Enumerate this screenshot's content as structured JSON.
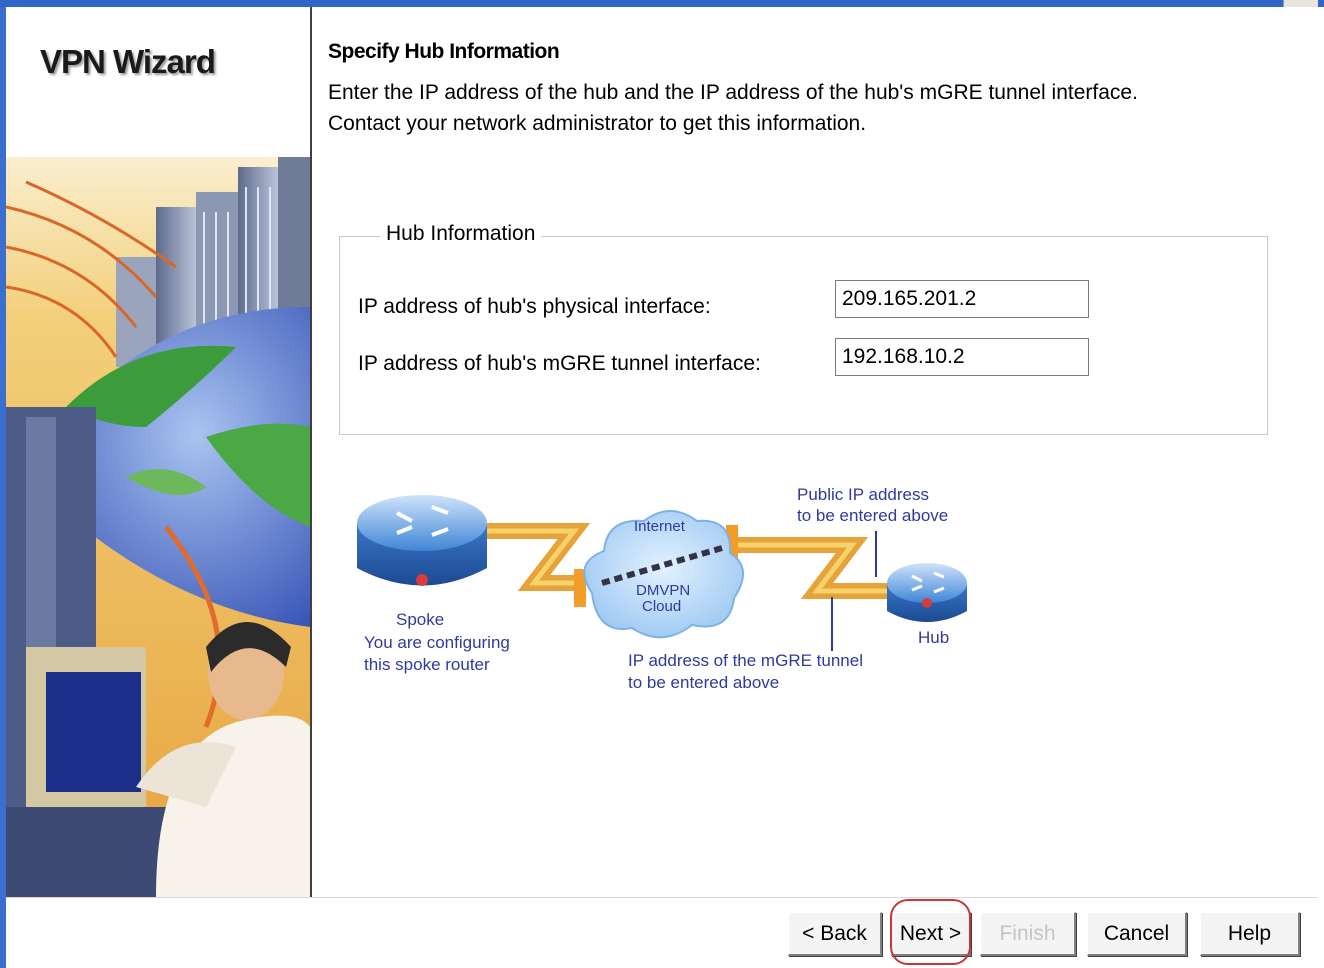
{
  "sidebar": {
    "title": "VPN Wizard"
  },
  "page": {
    "heading": "Specify Hub Information",
    "description_line1": "Enter the IP address of the hub and the IP address of the hub's mGRE tunnel interface.",
    "description_line2": "Contact your network administrator to get this information."
  },
  "hub_info": {
    "legend": "Hub Information",
    "physical_label": "IP address of hub's physical interface:",
    "physical_value": "209.165.201.2",
    "tunnel_label": "IP address of hub's mGRE tunnel interface:",
    "tunnel_value": "192.168.10.2"
  },
  "diagram": {
    "internet": "Internet",
    "cloud_line1": "DMVPN",
    "cloud_line2": "Cloud",
    "spoke": "Spoke",
    "spoke_note1": "You are configuring",
    "spoke_note2": "this spoke router",
    "public_note1": "Public IP address",
    "public_note2": "to be entered above",
    "hub": "Hub",
    "tunnel_note1": "IP address of the mGRE tunnel",
    "tunnel_note2": "to be entered above"
  },
  "buttons": {
    "back": "< Back",
    "next": "Next >",
    "finish": "Finish",
    "cancel": "Cancel",
    "help": "Help"
  },
  "colors": {
    "title_bar": "#2f66c8",
    "annotation_text": "#2e3a9e",
    "highlight": "#c8363a",
    "router_blue": "#3f86d6"
  }
}
